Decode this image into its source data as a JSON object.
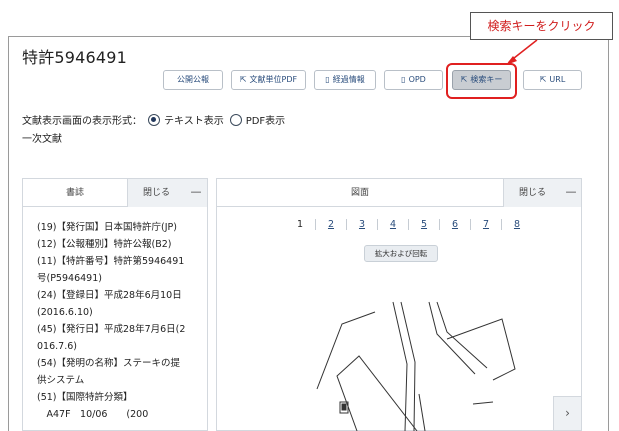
{
  "header": {
    "title": "特許5946491"
  },
  "toolbar": {
    "buttons": [
      {
        "label": "公開公報",
        "icon": ""
      },
      {
        "label": "文献単位PDF",
        "icon": "external-link-icon"
      },
      {
        "label": "経過情報",
        "icon": "document-icon"
      },
      {
        "label": "OPD",
        "icon": "document-icon"
      },
      {
        "label": "検索キー",
        "icon": "external-link-icon"
      },
      {
        "label": "URL",
        "icon": "external-link-icon"
      }
    ]
  },
  "annotation": {
    "callout": "検索キーをクリック",
    "color": "#d01c1c"
  },
  "display_format": {
    "label": "文献表示画面の表示形式：",
    "options": [
      "テキスト表示",
      "PDF表示"
    ],
    "selected": "テキスト表示"
  },
  "sub_heading": "一次文献",
  "biblio_panel": {
    "tab": "書誌",
    "close": "閉じる",
    "minimize": "—",
    "lines": [
      "(19)【発行国】日本国特許庁(JP)",
      "(12)【公報種別】特許公報(B2)",
      "(11)【特許番号】特許第5946491",
      "号(P5946491)",
      "(24)【登録日】平成28年6月10日",
      "(2016.6.10)",
      "(45)【発行日】平成28年7月6日(2",
      "016.7.6)",
      "(54)【発明の名称】ステーキの提",
      "供システム",
      "(51)【国際特許分類】",
      "　A47F　10/06　　(200"
    ]
  },
  "drawing_panel": {
    "tab": "図面",
    "close": "閉じる",
    "minimize": "—",
    "pages": [
      "1",
      "2",
      "3",
      "4",
      "5",
      "6",
      "7",
      "8"
    ],
    "current_page": "1",
    "zoom_label": "拡大および回転",
    "next": "›"
  }
}
